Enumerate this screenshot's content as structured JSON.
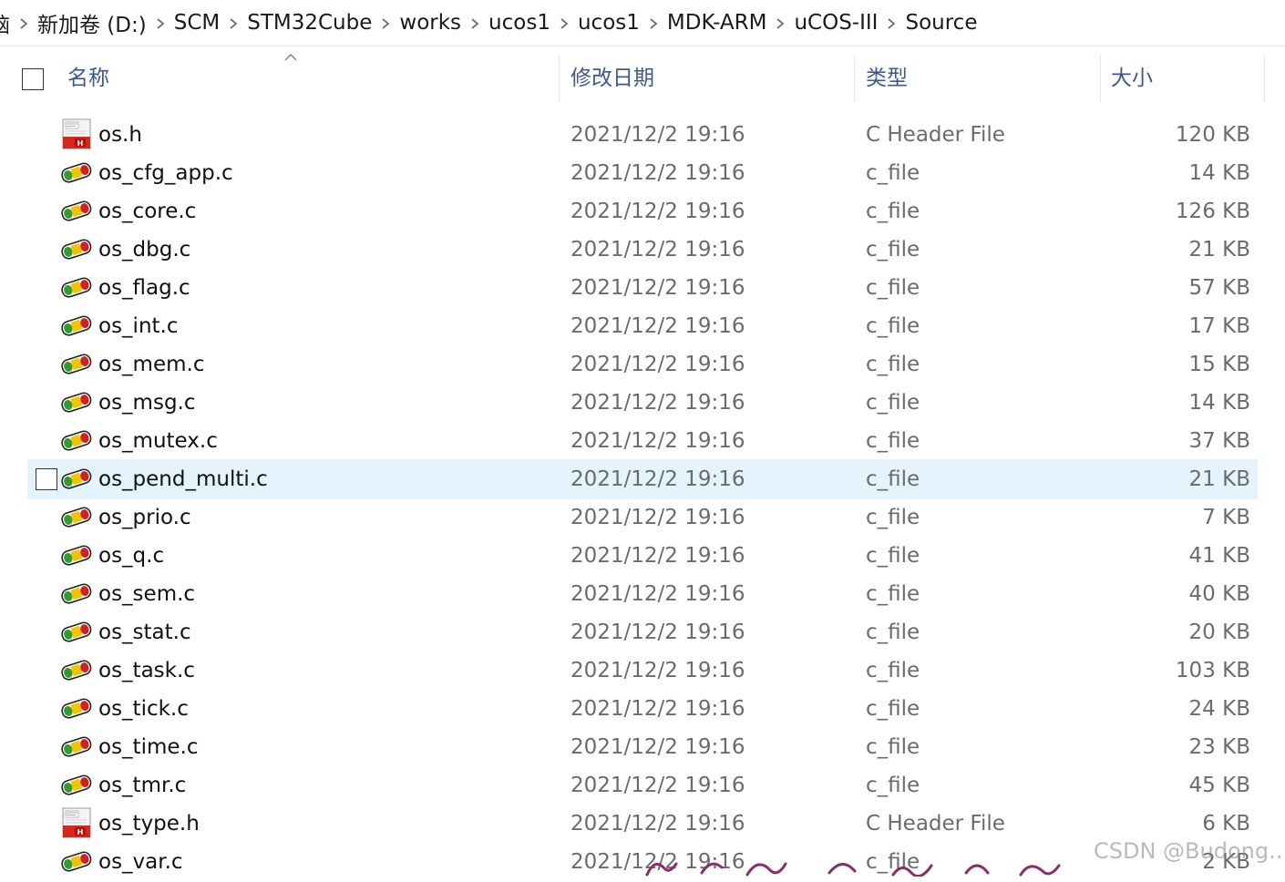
{
  "breadcrumb": {
    "items": [
      "脑",
      "新加卷 (D:)",
      "SCM",
      "STM32Cube",
      "works",
      "ucos1",
      "ucos1",
      "MDK-ARM",
      "uCOS-III",
      "Source"
    ]
  },
  "columns": {
    "name": "名称",
    "date": "修改日期",
    "type": "类型",
    "size": "大小"
  },
  "files": [
    {
      "name": "os.h",
      "date": "2021/12/2 19:16",
      "type": "C Header File",
      "size": "120 KB",
      "icon": "header-file-icon"
    },
    {
      "name": "os_cfg_app.c",
      "date": "2021/12/2 19:16",
      "type": "c_file",
      "size": "14 KB",
      "icon": "keil-c-file-icon"
    },
    {
      "name": "os_core.c",
      "date": "2021/12/2 19:16",
      "type": "c_file",
      "size": "126 KB",
      "icon": "keil-c-file-icon"
    },
    {
      "name": "os_dbg.c",
      "date": "2021/12/2 19:16",
      "type": "c_file",
      "size": "21 KB",
      "icon": "keil-c-file-icon"
    },
    {
      "name": "os_flag.c",
      "date": "2021/12/2 19:16",
      "type": "c_file",
      "size": "57 KB",
      "icon": "keil-c-file-icon"
    },
    {
      "name": "os_int.c",
      "date": "2021/12/2 19:16",
      "type": "c_file",
      "size": "17 KB",
      "icon": "keil-c-file-icon"
    },
    {
      "name": "os_mem.c",
      "date": "2021/12/2 19:16",
      "type": "c_file",
      "size": "15 KB",
      "icon": "keil-c-file-icon"
    },
    {
      "name": "os_msg.c",
      "date": "2021/12/2 19:16",
      "type": "c_file",
      "size": "14 KB",
      "icon": "keil-c-file-icon"
    },
    {
      "name": "os_mutex.c",
      "date": "2021/12/2 19:16",
      "type": "c_file",
      "size": "37 KB",
      "icon": "keil-c-file-icon"
    },
    {
      "name": "os_pend_multi.c",
      "date": "2021/12/2 19:16",
      "type": "c_file",
      "size": "21 KB",
      "icon": "keil-c-file-icon",
      "hovered": true
    },
    {
      "name": "os_prio.c",
      "date": "2021/12/2 19:16",
      "type": "c_file",
      "size": "7 KB",
      "icon": "keil-c-file-icon"
    },
    {
      "name": "os_q.c",
      "date": "2021/12/2 19:16",
      "type": "c_file",
      "size": "41 KB",
      "icon": "keil-c-file-icon"
    },
    {
      "name": "os_sem.c",
      "date": "2021/12/2 19:16",
      "type": "c_file",
      "size": "40 KB",
      "icon": "keil-c-file-icon"
    },
    {
      "name": "os_stat.c",
      "date": "2021/12/2 19:16",
      "type": "c_file",
      "size": "20 KB",
      "icon": "keil-c-file-icon"
    },
    {
      "name": "os_task.c",
      "date": "2021/12/2 19:16",
      "type": "c_file",
      "size": "103 KB",
      "icon": "keil-c-file-icon"
    },
    {
      "name": "os_tick.c",
      "date": "2021/12/2 19:16",
      "type": "c_file",
      "size": "24 KB",
      "icon": "keil-c-file-icon"
    },
    {
      "name": "os_time.c",
      "date": "2021/12/2 19:16",
      "type": "c_file",
      "size": "23 KB",
      "icon": "keil-c-file-icon"
    },
    {
      "name": "os_tmr.c",
      "date": "2021/12/2 19:16",
      "type": "c_file",
      "size": "45 KB",
      "icon": "keil-c-file-icon"
    },
    {
      "name": "os_type.h",
      "date": "2021/12/2 19:16",
      "type": "C Header File",
      "size": "6 KB",
      "icon": "header-file-icon"
    },
    {
      "name": "os_var.c",
      "date": "2021/12/2 19:16",
      "type": "c_file",
      "size": "2 KB",
      "icon": "keil-c-file-icon"
    }
  ],
  "watermark": "CSDN @Budong..",
  "colors": {
    "hover_row": "#e5f3fd",
    "header_text": "#3c5a8a",
    "detail_text": "#6b6b6b"
  }
}
